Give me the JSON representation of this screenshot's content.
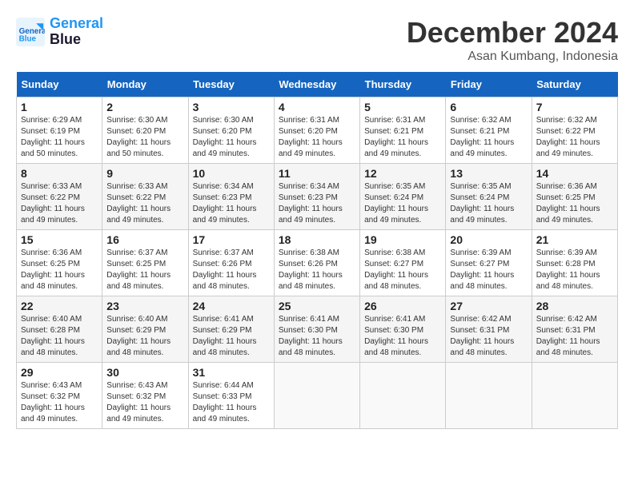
{
  "logo": {
    "line1": "General",
    "line2": "Blue"
  },
  "title": "December 2024",
  "subtitle": "Asan Kumbang, Indonesia",
  "days_of_week": [
    "Sunday",
    "Monday",
    "Tuesday",
    "Wednesday",
    "Thursday",
    "Friday",
    "Saturday"
  ],
  "weeks": [
    [
      {
        "day": "1",
        "sunrise": "6:29 AM",
        "sunset": "6:19 PM",
        "daylight": "11 hours and 50 minutes."
      },
      {
        "day": "2",
        "sunrise": "6:30 AM",
        "sunset": "6:20 PM",
        "daylight": "11 hours and 50 minutes."
      },
      {
        "day": "3",
        "sunrise": "6:30 AM",
        "sunset": "6:20 PM",
        "daylight": "11 hours and 49 minutes."
      },
      {
        "day": "4",
        "sunrise": "6:31 AM",
        "sunset": "6:20 PM",
        "daylight": "11 hours and 49 minutes."
      },
      {
        "day": "5",
        "sunrise": "6:31 AM",
        "sunset": "6:21 PM",
        "daylight": "11 hours and 49 minutes."
      },
      {
        "day": "6",
        "sunrise": "6:32 AM",
        "sunset": "6:21 PM",
        "daylight": "11 hours and 49 minutes."
      },
      {
        "day": "7",
        "sunrise": "6:32 AM",
        "sunset": "6:22 PM",
        "daylight": "11 hours and 49 minutes."
      }
    ],
    [
      {
        "day": "8",
        "sunrise": "6:33 AM",
        "sunset": "6:22 PM",
        "daylight": "11 hours and 49 minutes."
      },
      {
        "day": "9",
        "sunrise": "6:33 AM",
        "sunset": "6:22 PM",
        "daylight": "11 hours and 49 minutes."
      },
      {
        "day": "10",
        "sunrise": "6:34 AM",
        "sunset": "6:23 PM",
        "daylight": "11 hours and 49 minutes."
      },
      {
        "day": "11",
        "sunrise": "6:34 AM",
        "sunset": "6:23 PM",
        "daylight": "11 hours and 49 minutes."
      },
      {
        "day": "12",
        "sunrise": "6:35 AM",
        "sunset": "6:24 PM",
        "daylight": "11 hours and 49 minutes."
      },
      {
        "day": "13",
        "sunrise": "6:35 AM",
        "sunset": "6:24 PM",
        "daylight": "11 hours and 49 minutes."
      },
      {
        "day": "14",
        "sunrise": "6:36 AM",
        "sunset": "6:25 PM",
        "daylight": "11 hours and 49 minutes."
      }
    ],
    [
      {
        "day": "15",
        "sunrise": "6:36 AM",
        "sunset": "6:25 PM",
        "daylight": "11 hours and 48 minutes."
      },
      {
        "day": "16",
        "sunrise": "6:37 AM",
        "sunset": "6:25 PM",
        "daylight": "11 hours and 48 minutes."
      },
      {
        "day": "17",
        "sunrise": "6:37 AM",
        "sunset": "6:26 PM",
        "daylight": "11 hours and 48 minutes."
      },
      {
        "day": "18",
        "sunrise": "6:38 AM",
        "sunset": "6:26 PM",
        "daylight": "11 hours and 48 minutes."
      },
      {
        "day": "19",
        "sunrise": "6:38 AM",
        "sunset": "6:27 PM",
        "daylight": "11 hours and 48 minutes."
      },
      {
        "day": "20",
        "sunrise": "6:39 AM",
        "sunset": "6:27 PM",
        "daylight": "11 hours and 48 minutes."
      },
      {
        "day": "21",
        "sunrise": "6:39 AM",
        "sunset": "6:28 PM",
        "daylight": "11 hours and 48 minutes."
      }
    ],
    [
      {
        "day": "22",
        "sunrise": "6:40 AM",
        "sunset": "6:28 PM",
        "daylight": "11 hours and 48 minutes."
      },
      {
        "day": "23",
        "sunrise": "6:40 AM",
        "sunset": "6:29 PM",
        "daylight": "11 hours and 48 minutes."
      },
      {
        "day": "24",
        "sunrise": "6:41 AM",
        "sunset": "6:29 PM",
        "daylight": "11 hours and 48 minutes."
      },
      {
        "day": "25",
        "sunrise": "6:41 AM",
        "sunset": "6:30 PM",
        "daylight": "11 hours and 48 minutes."
      },
      {
        "day": "26",
        "sunrise": "6:41 AM",
        "sunset": "6:30 PM",
        "daylight": "11 hours and 48 minutes."
      },
      {
        "day": "27",
        "sunrise": "6:42 AM",
        "sunset": "6:31 PM",
        "daylight": "11 hours and 48 minutes."
      },
      {
        "day": "28",
        "sunrise": "6:42 AM",
        "sunset": "6:31 PM",
        "daylight": "11 hours and 48 minutes."
      }
    ],
    [
      {
        "day": "29",
        "sunrise": "6:43 AM",
        "sunset": "6:32 PM",
        "daylight": "11 hours and 49 minutes."
      },
      {
        "day": "30",
        "sunrise": "6:43 AM",
        "sunset": "6:32 PM",
        "daylight": "11 hours and 49 minutes."
      },
      {
        "day": "31",
        "sunrise": "6:44 AM",
        "sunset": "6:33 PM",
        "daylight": "11 hours and 49 minutes."
      },
      {
        "day": "",
        "sunrise": "",
        "sunset": "",
        "daylight": ""
      },
      {
        "day": "",
        "sunrise": "",
        "sunset": "",
        "daylight": ""
      },
      {
        "day": "",
        "sunrise": "",
        "sunset": "",
        "daylight": ""
      },
      {
        "day": "",
        "sunrise": "",
        "sunset": "",
        "daylight": ""
      }
    ]
  ]
}
